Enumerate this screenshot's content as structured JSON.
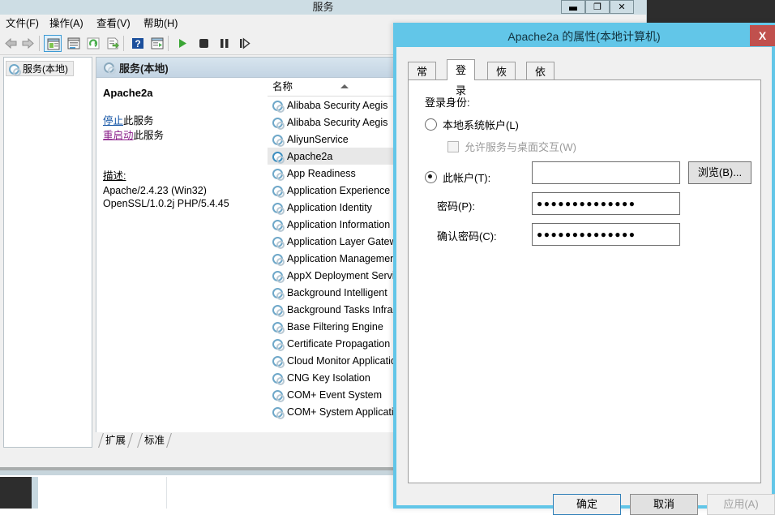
{
  "mmc": {
    "title": "服务",
    "window_controls": [
      {
        "name": "minimize",
        "glyph": "▬"
      },
      {
        "name": "maximize",
        "glyph": "❐"
      },
      {
        "name": "close",
        "glyph": "✕"
      }
    ],
    "menus": [
      "文件(F)",
      "操作(A)",
      "查看(V)",
      "帮助(H)"
    ],
    "toolbar_icons": [
      "back-arrow-icon",
      "forward-arrow-icon",
      "show-hide-console-tree-icon",
      "properties-icon",
      "refresh-icon",
      "export-list-icon",
      "help-icon",
      "show-hide-action-pane-icon",
      "start-service-icon",
      "stop-service-icon",
      "pause-service-icon",
      "restart-service-icon"
    ],
    "tree": {
      "root_label": "服务(本地)"
    },
    "pane_header": "服务(本地)",
    "detail": {
      "service_name": "Apache2a",
      "stop_link_hot": "停止",
      "stop_link_rest": "此服务",
      "restart_link_hot": "重启动",
      "restart_link_rest": "此服务",
      "description_label": "描述:",
      "description_lines": [
        "Apache/2.4.23 (Win32)",
        "OpenSSL/1.0.2j PHP/5.4.45"
      ]
    },
    "list": {
      "column_header": "名称",
      "sort_direction": "ascending",
      "selected": "Apache2a",
      "rows": [
        "Alibaba Security Aegis",
        "Alibaba Security Aegis",
        "AliyunService",
        "Apache2a",
        "App Readiness",
        "Application Experience",
        "Application Identity",
        "Application Information",
        "Application Layer Gateway",
        "Application Management",
        "AppX Deployment Service",
        "Background Intelligent",
        "Background Tasks Infra",
        "Base Filtering Engine",
        "Certificate Propagation",
        "Cloud Monitor Application",
        "CNG Key Isolation",
        "COM+ Event System",
        "COM+ System Application"
      ]
    },
    "pane_tabs": [
      "扩展",
      "标准"
    ]
  },
  "dialog": {
    "title": "Apache2a 的属性(本地计算机)",
    "close_glyph": "X",
    "tabs": [
      {
        "label": "常规",
        "active": false
      },
      {
        "label": "登录",
        "active": true
      },
      {
        "label": "恢复",
        "active": false
      },
      {
        "label": "依存关系",
        "active": false
      }
    ],
    "logon": {
      "group_label": "登录身份:",
      "local_system_label": "本地系统帐户(L)",
      "local_system_checked": false,
      "allow_desktop_label": "允许服务与桌面交互(W)",
      "allow_desktop_checked": false,
      "allow_desktop_enabled": false,
      "this_account_label": "此帐户(T):",
      "this_account_checked": true,
      "account_value": "",
      "browse_label": "浏览(B)...",
      "password_label": "密码(P):",
      "password_value": "●●●●●●●●●●●●●●",
      "confirm_label": "确认密码(C):",
      "confirm_value": "●●●●●●●●●●●●●●"
    },
    "buttons": {
      "ok": "确定",
      "cancel": "取消",
      "apply": "应用(A)"
    }
  },
  "colors": {
    "dialog_border": "#62c6e8",
    "dialog_titlebar": "#62c6e8",
    "close_button": "#c0504d",
    "mmc_titlebar": "#cddde4",
    "pane_header_top": "#d7e4ee",
    "stop_link": "#0b4ea2",
    "restart_link": "#8a1f8a",
    "desktop_dark": "#2d2d2d"
  }
}
